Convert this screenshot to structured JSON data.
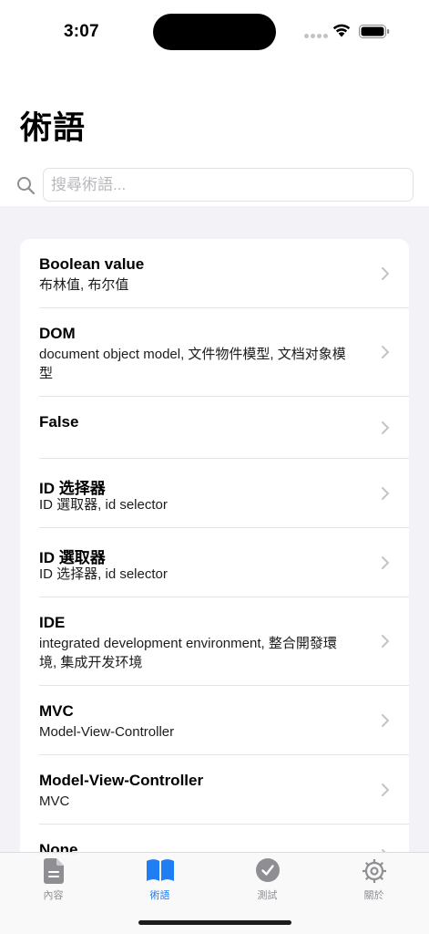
{
  "status_bar": {
    "time": "3:07"
  },
  "header": {
    "title": "術語"
  },
  "search": {
    "placeholder": "搜尋術語..."
  },
  "terms": [
    {
      "title": "Boolean value",
      "subtitle": "布林值, 布尔值"
    },
    {
      "title": "DOM",
      "subtitle": "document object model, 文件物件模型, 文档对象模型"
    },
    {
      "title": "False",
      "subtitle": ""
    },
    {
      "title": "ID 选择器",
      "subtitle": "ID 選取器, id selector"
    },
    {
      "title": "ID 選取器",
      "subtitle": "ID 选择器, id selector"
    },
    {
      "title": "IDE",
      "subtitle": "integrated development environment, 整合開發環境, 集成开发环境"
    },
    {
      "title": "MVC",
      "subtitle": "Model-View-Controller"
    },
    {
      "title": "Model-View-Controller",
      "subtitle": "MVC"
    },
    {
      "title": "None",
      "subtitle": ""
    }
  ],
  "tabs": [
    {
      "label": "內容",
      "icon": "document-icon",
      "active": false
    },
    {
      "label": "術語",
      "icon": "book-icon",
      "active": true
    },
    {
      "label": "測試",
      "icon": "checkmark-circle-icon",
      "active": false
    },
    {
      "label": "關於",
      "icon": "gear-icon",
      "active": false
    }
  ],
  "colors": {
    "accent": "#1f7ef2",
    "inactive": "#8e8e93",
    "background": "#f2f2f7"
  }
}
